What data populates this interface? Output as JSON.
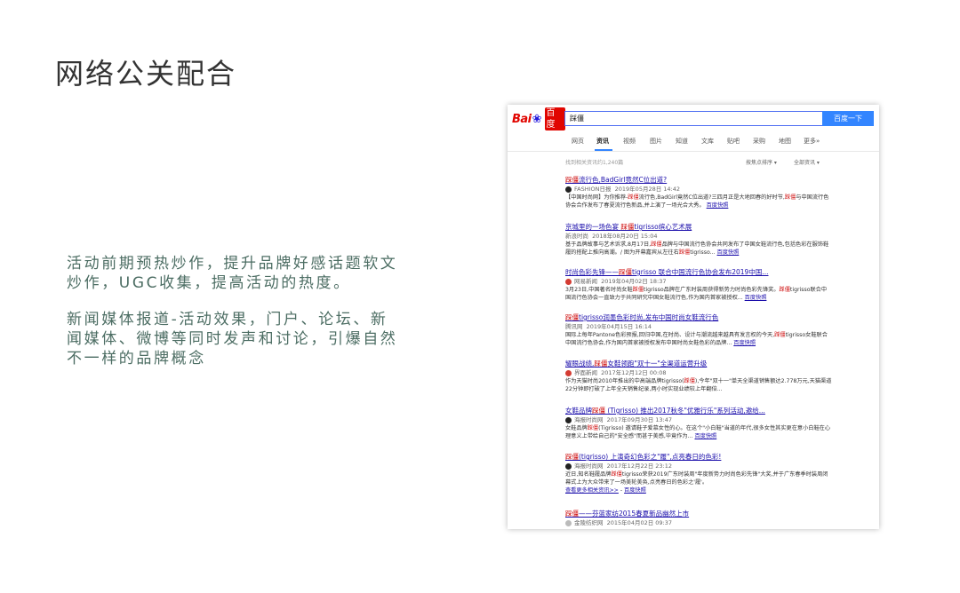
{
  "slide": {
    "title": "网络公关配合",
    "para1": "活动前期预热炒作，提升品牌好感话题软文炒作，UGC收集，提高活动的热度。",
    "para2": "新闻媒体报道-活动效果，门户、论坛、新闻媒体、微博等同时发声和讨论，引爆自然不一样的品牌概念"
  },
  "baidu": {
    "logo_bai": "Bai",
    "logo_du": "百度",
    "query": "踩僵",
    "search_button": "百度一下",
    "tabs": [
      "网页",
      "资讯",
      "视频",
      "图片",
      "知道",
      "文库",
      "贴吧",
      "采购",
      "地图",
      "更多»"
    ],
    "stats": "找到相关资讯约1,240篇",
    "sort_label": "按焦点排序 ▾",
    "filter_label": "全部资讯 ▾",
    "snapshot_label": "百度快照",
    "more_news": "查看更多相关资讯>>",
    "results": [
      {
        "title_hl": "踩僵",
        "title": "流行色,BadGirl竟然C位出道?",
        "source": "FASHION日报",
        "time": "2019年05月28日 14:42",
        "abstract": "【中国时尚网】为你推荐-踩僵流行色,BadGirl竟然C位出道?三四月正是大地回春的好时节,踩僵与中国流行色协会合作发布了春夏流行色新品,并上演了一场光合大秀。"
      },
      {
        "title_hl": "",
        "title": "京城里的一场色宴 踩僵tigrisso缤心艺术展",
        "source": "新浪时尚",
        "time": "2018年08月20日 15:04",
        "abstract": "基于品牌故事与艺术诉求,8月17日,踩僵品牌与中国流行色协会共同发布了中国女鞋流行色,包括色彩在服饰鞋履的搭配上推向高潮。/ 图为开幕嘉宾从左往右踩僵tigrisso..."
      },
      {
        "title_hl": "",
        "title": "时尚色彩先锋——踩僵tigrisso 联合中国流行色协会发布2019中国...",
        "source": "网易新闻",
        "time": "2019年04月02日 18:37",
        "abstract": "3月23日,中国著名时尚女鞋踩僵tigrisso品牌在广东时装周获得新势力时尚色彩先锋奖。踩僵tigrisso联合中国流行色协会一直致力于共同研究中国女鞋流行色,作为国内首家被授权..."
      },
      {
        "title_hl": "",
        "title": "踩僵tigrisso润墨色彩时尚,发布中国时尚女鞋流行色",
        "source": "腾讯网",
        "time": "2019年04月15日 16:14",
        "abstract": "国际上每年Pantone色彩预报,回归中国,在时尚、设计与潮流越来越具有发言权的今天,踩僵tigrisso女鞋联合中国流行色协会,作为国内首家被授权发布中国时尚女鞋色彩的品牌..."
      },
      {
        "title_hl": "",
        "title": "耀眼战绩,踩僵女鞋领跑\"双十一\"全渠道运营升级",
        "source": "界面新闻",
        "time": "2017年12月12日 00:08",
        "abstract": "作为天猫时尚2010年推出的中高端品牌tigrisso(踩僵),今年\"双十一\"单天全渠道销售额达2.778万元,天猫渠道22分钟即打破了上年全天销售纪录,两小时实现业绩较上年翻倍..."
      },
      {
        "title_hl": "",
        "title": "女鞋品牌踩僵 (Tigrisso) 推出2017秋冬\"优雅行乐\"系列活动,邀给...",
        "source": "海报时尚网",
        "time": "2017年09月30日 13:47",
        "abstract": "女鞋品牌踩僵(Tigrisso) 邀请鞋子爱慕女性的心。在这个\"小白鞋\"当道的年代,很多女性其实更在意小白鞋在心理意义上带给自己的\"安全感\"而甚于美感,毕竟作为..."
      },
      {
        "title_hl": "",
        "title": "踩僵(tigrisso) 上演奇幻色彩之\"履\",点亮春日的色彩!",
        "source": "海报时尚网",
        "time": "2017年12月22日 23:12",
        "abstract": "近日,知名鞋履品牌踩僵tigrisso荣获2019广东时装周\"年度新势力时尚色彩先锋\"大奖,并于广东春季时装周闭幕式上为大众带来了一场美轮美奂,点亮春日的色彩之'履'。"
      },
      {
        "title_hl": "",
        "title": "踩僵——芬蓝家纺2015春夏新品幽然上市",
        "source": "金陵纺织网",
        "time": "2015年04月02日 09:37",
        "abstract": ""
      }
    ]
  },
  "colors": {
    "title_text": "#333333",
    "body_text": "#4c6d63",
    "link": "#1a0dab",
    "highlight": "#cc0000",
    "baidu_blue": "#3385ff",
    "baidu_red": "#e10601"
  }
}
